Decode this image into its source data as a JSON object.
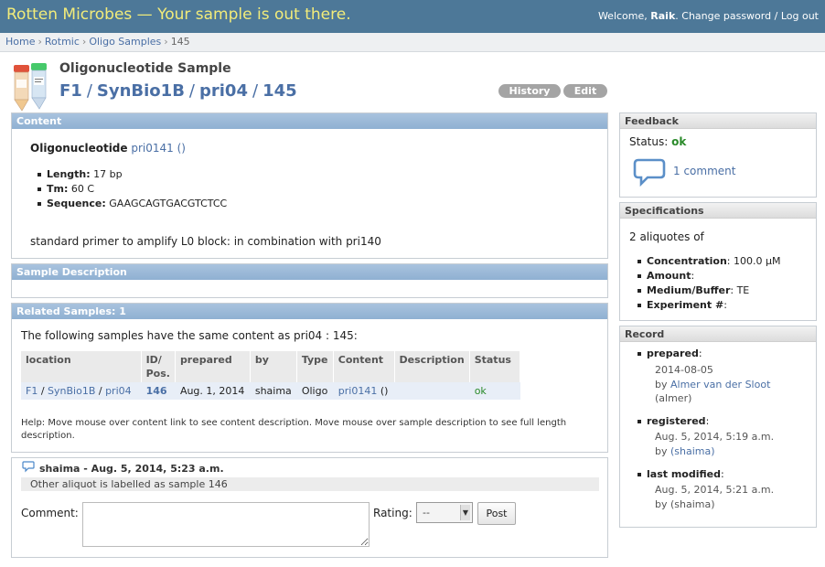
{
  "header": {
    "site_title": "Rotten Microbes — Your sample is out there.",
    "welcome": "Welcome,",
    "username": "Raik",
    "change_password": "Change password",
    "separator": "/",
    "logout": "Log out"
  },
  "breadcrumb": {
    "items": [
      "Home",
      "Rotmic",
      "Oligo Samples"
    ],
    "current": "145",
    "sep": "›"
  },
  "page": {
    "kind": "Oligonucleotide Sample",
    "path": [
      "F1",
      "SynBio1B",
      "pri04",
      "145"
    ],
    "history_label": "History",
    "edit_label": "Edit"
  },
  "content": {
    "heading": "Content",
    "type_label": "Oligonucleotide",
    "oligo_link": "pri0141 ()",
    "length_label": "Length:",
    "length_value": "17 bp",
    "tm_label": "Tm:",
    "tm_value": "60 C",
    "sequence_label": "Sequence:",
    "sequence_value": "GAAGCAGTGACGTCTCC",
    "description": "standard primer to amplify L0 block: in combination with pri140"
  },
  "sample_description": {
    "heading": "Sample Description"
  },
  "related": {
    "heading": "Related Samples: 1",
    "intro": "The following samples have the same content as pri04 : 145:",
    "columns": [
      "location",
      "ID/ Pos.",
      "prepared",
      "by",
      "Type",
      "Content",
      "Description",
      "Status"
    ],
    "rows": [
      {
        "loc1": "F1",
        "loc2": "SynBio1B",
        "loc3": "pri04",
        "id": "146",
        "prepared": "Aug. 1, 2014",
        "by": "shaima",
        "type": "Oligo",
        "content_link": "pri0141",
        "content_suffix": "()",
        "description": "",
        "status": "ok"
      }
    ],
    "help": "Help: Move mouse over content link to see content description. Move mouse over sample description to see full length description."
  },
  "comments": {
    "author_line": "shaima - Aug. 5, 2014, 5:23 a.m.",
    "text": "Other aliquot is labelled as sample 146",
    "comment_label": "Comment:",
    "comment_value": "",
    "rating_label": "Rating:",
    "rating_value": "--",
    "post_label": "Post"
  },
  "feedback": {
    "heading": "Feedback",
    "status_label": "Status:",
    "status_value": "ok",
    "comment_count": "1 comment"
  },
  "specifications": {
    "heading": "Specifications",
    "aliquots": "2 aliquotes of",
    "concentration_label": "Concentration",
    "concentration_value": ": 100.0 µM",
    "amount_label": "Amount",
    "amount_value": ":",
    "medium_label": "Medium/Buffer",
    "medium_value": ": TE",
    "experiment_label": "Experiment #",
    "experiment_value": ":"
  },
  "record": {
    "heading": "Record",
    "prepared_label": "prepared",
    "prepared_date": "2014-08-05",
    "prepared_by_prefix": "by",
    "prepared_by": "Almer van der Sloot",
    "prepared_by_user": "(almer)",
    "registered_label": "registered",
    "registered_date": "Aug. 5, 2014, 5:19 a.m.",
    "registered_by_prefix": "by",
    "registered_by": "(shaima)",
    "modified_label": "last modified",
    "modified_date": "Aug. 5, 2014, 5:21 a.m.",
    "modified_by": "by (shaima)"
  },
  "colors": {
    "header_bg": "#4d7898",
    "site_title": "#f2ec7a",
    "panel_head": "#9ab8d8",
    "link": "#4a6fa5",
    "ok": "#2a8a2a"
  }
}
